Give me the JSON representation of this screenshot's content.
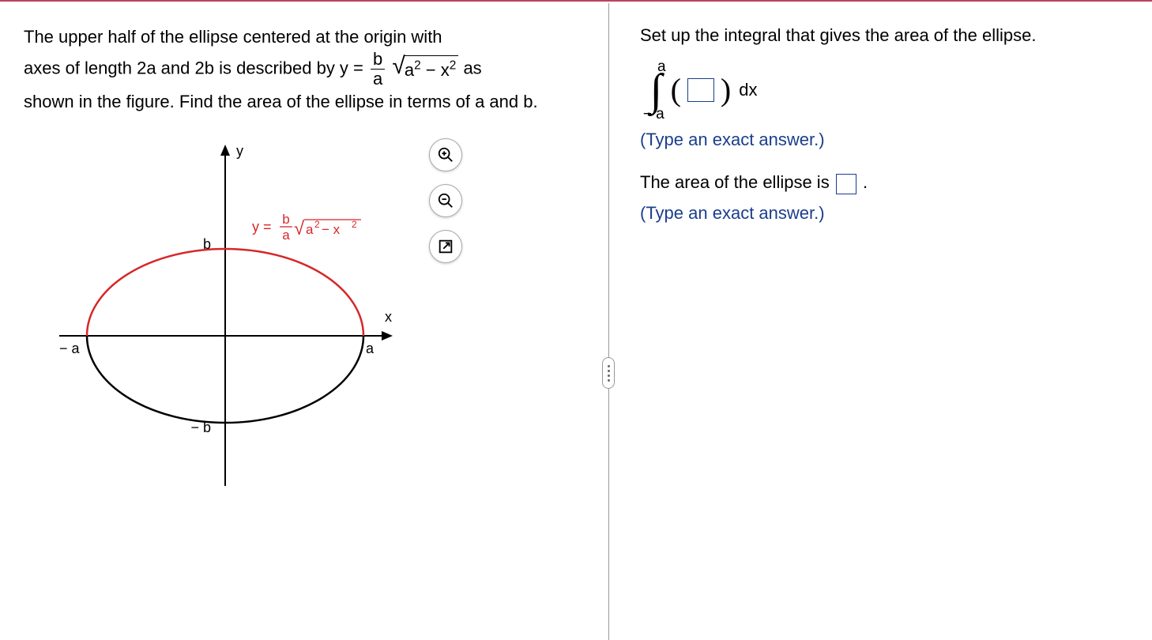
{
  "left": {
    "problem_line1": "The upper half of the ellipse centered at the origin with",
    "problem_line2a": "axes of length 2a and 2b is described by y = ",
    "problem_frac_num": "b",
    "problem_frac_den": "a",
    "problem_rad_content_html": "a² − x²",
    "problem_line2b": " as",
    "problem_line3": "shown in the figure. Find the area of the ellipse in terms of a and b.",
    "figure": {
      "y_label": "y",
      "x_label": "x",
      "a_label": "a",
      "neg_a_label": "− a",
      "b_label": "b",
      "neg_b_label": "− b",
      "curve_label_prefix": "y = ",
      "curve_frac_num": "b",
      "curve_frac_den": "a",
      "curve_rad": "a² − x²"
    }
  },
  "right": {
    "prompt1": "Set up the integral that gives the area of the ellipse.",
    "int_upper": "a",
    "int_lower": "− a",
    "dx": "dx",
    "hint1": "(Type an exact answer.)",
    "area_sentence_prefix": "The area of the ellipse is ",
    "area_sentence_suffix": ".",
    "hint2": "(Type an exact answer.)"
  },
  "chart_data": {
    "type": "line",
    "description": "Ellipse centered at origin with semi-axes a (horizontal) and b (vertical). Upper half drawn in red, lower half in black.",
    "x_range": [
      "-a",
      "a"
    ],
    "y_range": [
      "-b",
      "b"
    ],
    "series": [
      {
        "name": "upper-half",
        "equation": "y = (b/a) * sqrt(a^2 - x^2)",
        "color": "#d62728"
      },
      {
        "name": "lower-half",
        "equation": "y = -(b/a) * sqrt(a^2 - x^2)",
        "color": "#000000"
      }
    ],
    "axis_labels": {
      "x": "x",
      "y": "y"
    },
    "tick_labels": {
      "x": [
        "− a",
        "a"
      ],
      "y": [
        "− b",
        "b"
      ]
    }
  }
}
